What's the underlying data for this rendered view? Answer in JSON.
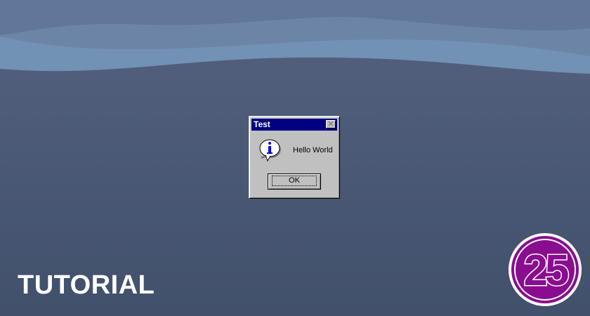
{
  "dialog": {
    "title": "Test",
    "message": "Hello World",
    "ok_label": "OK",
    "close_glyph": "✕",
    "icon": "info-icon"
  },
  "banner": {
    "label": "TUTORIAL",
    "logo_text": "25"
  },
  "colors": {
    "titlebar": "#000080",
    "logo": "#8a0d8f"
  }
}
